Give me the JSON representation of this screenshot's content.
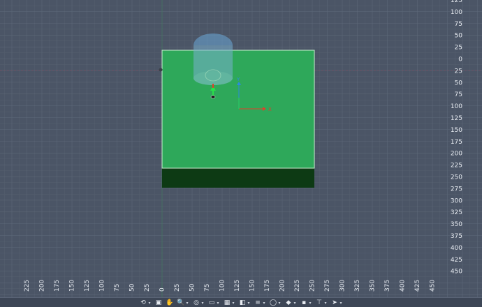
{
  "viewport": {
    "background": "#4b5566",
    "grid_minor_color": "#56606f",
    "grid_major_color": "#5f6a7a",
    "origin_x_axis_color": "#8a4a5a",
    "origin_y_axis_color": "#3f7a5a"
  },
  "rulers": {
    "right_labels": [
      "125",
      "100",
      "75",
      "50",
      "25",
      "0",
      "25",
      "50",
      "75",
      "100",
      "125",
      "150",
      "175",
      "200",
      "225",
      "250",
      "275",
      "300",
      "325",
      "350",
      "375",
      "400",
      "425",
      "450"
    ],
    "bottom_labels": [
      "225",
      "200",
      "175",
      "150",
      "125",
      "100",
      "75",
      "50",
      "25",
      "0",
      "25",
      "50",
      "75",
      "100",
      "125",
      "150",
      "175",
      "200",
      "225",
      "250",
      "275",
      "300",
      "325",
      "350",
      "375",
      "400",
      "425",
      "450"
    ]
  },
  "scene": {
    "plate_color": "#2ea85a",
    "plate_edge_color": "#c9f0d0",
    "plate_side_color": "#0d3a14",
    "tool_color": "#6aa8d8",
    "axis_x_color": "#e0402a",
    "axis_y_color": "#2a8ae0",
    "axis_x_label": "X",
    "axis_y_label": "Y"
  },
  "toolbar": {
    "add_label": "+",
    "buttons": [
      {
        "name": "orbit-icon",
        "glyph": "⟲",
        "caret": true
      },
      {
        "name": "fit-view-icon",
        "glyph": "▣",
        "caret": false
      },
      {
        "name": "pan-hand-icon",
        "glyph": "✋",
        "caret": false
      },
      {
        "name": "zoom-icon",
        "glyph": "🔍",
        "caret": true
      },
      {
        "name": "zoom-window-icon",
        "glyph": "◎",
        "caret": true
      },
      {
        "name": "display-monitor-icon",
        "glyph": "▭",
        "caret": true
      },
      {
        "name": "grid-icon",
        "glyph": "▦",
        "caret": true
      },
      {
        "name": "view-cube-icon",
        "glyph": "◧",
        "caret": true
      },
      {
        "name": "layers-icon",
        "glyph": "≡",
        "caret": true
      },
      {
        "name": "sphere-icon",
        "glyph": "◯",
        "caret": true
      },
      {
        "name": "diamond-icon",
        "glyph": "◆",
        "caret": true
      },
      {
        "name": "camera-icon",
        "glyph": "▪",
        "caret": true
      },
      {
        "name": "probe-icon",
        "glyph": "⊤",
        "caret": true
      },
      {
        "name": "simulation-icon",
        "glyph": "➤",
        "caret": true
      }
    ]
  }
}
